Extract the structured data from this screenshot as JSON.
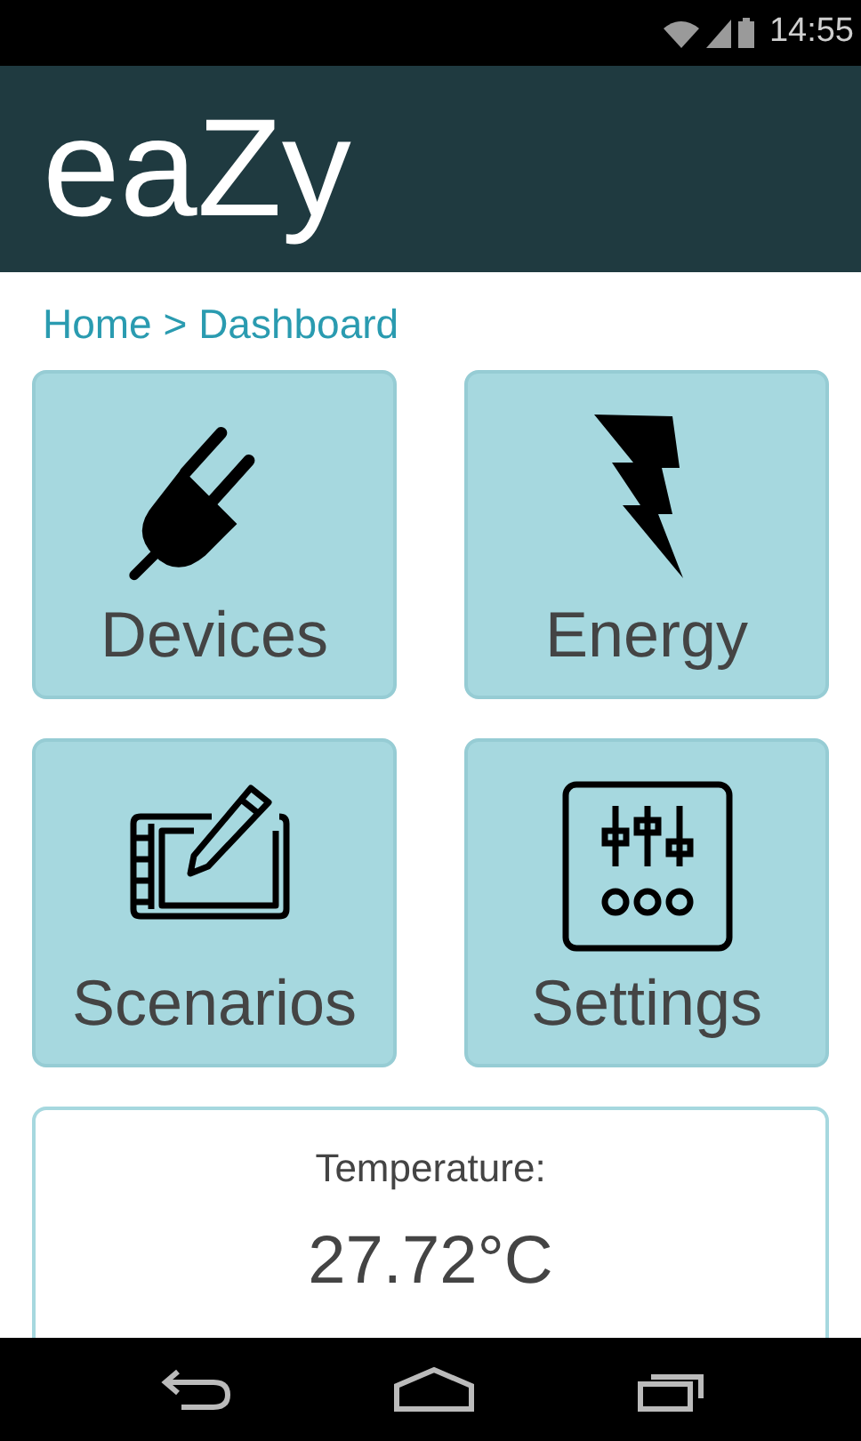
{
  "status_bar": {
    "time": "14:55"
  },
  "header": {
    "title": "eaZy"
  },
  "breadcrumb": "Home > Dashboard",
  "tiles": [
    {
      "label": "Devices",
      "kind": "plug"
    },
    {
      "label": "Energy",
      "kind": "bolt"
    },
    {
      "label": "Scenarios",
      "kind": "tablet"
    },
    {
      "label": "Settings",
      "kind": "sliders"
    }
  ],
  "temperature": {
    "label": "Temperature:",
    "value": "27.72°C"
  }
}
